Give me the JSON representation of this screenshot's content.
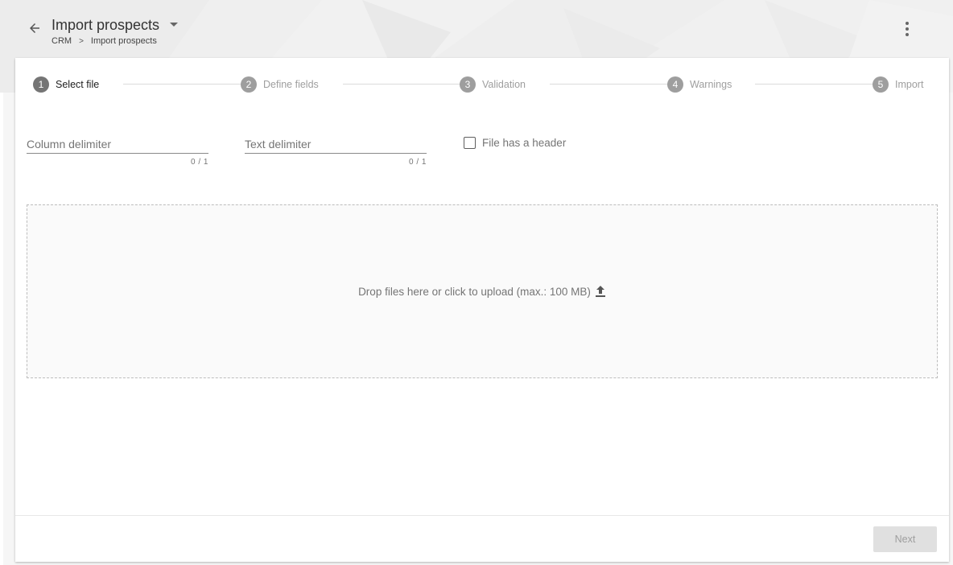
{
  "header": {
    "title": "Import prospects",
    "breadcrumb": [
      "CRM",
      "Import prospects"
    ],
    "back_icon": "arrow-left-icon",
    "menu_icon": "more-vertical-icon"
  },
  "stepper": {
    "steps": [
      {
        "number": "1",
        "label": "Select file",
        "active": true
      },
      {
        "number": "2",
        "label": "Define fields",
        "active": false
      },
      {
        "number": "3",
        "label": "Validation",
        "active": false
      },
      {
        "number": "4",
        "label": "Warnings",
        "active": false
      },
      {
        "number": "5",
        "label": "Import",
        "active": false
      }
    ]
  },
  "form": {
    "column_delimiter": {
      "placeholder": "Column delimiter",
      "value": "",
      "counter": "0 / 1"
    },
    "text_delimiter": {
      "placeholder": "Text delimiter",
      "value": "",
      "counter": "0 / 1"
    },
    "has_header": {
      "label": "File has a header",
      "checked": false
    }
  },
  "dropzone": {
    "text": "Drop files here or click to upload (max.: 100 MB)",
    "icon": "upload-icon"
  },
  "footer": {
    "next_label": "Next"
  },
  "colors": {
    "accent": "#757575",
    "disabled_button": "#e0e0e0",
    "text": "#333333"
  }
}
